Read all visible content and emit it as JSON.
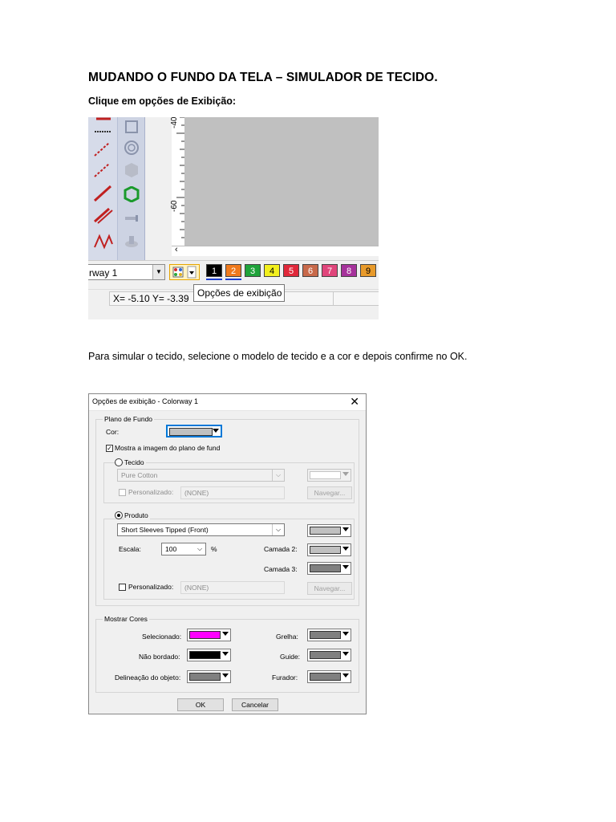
{
  "heading": "MUDANDO O FUNDO DA TELA – SIMULADOR DE TECIDO.",
  "instruction1": "Clique em opções de Exibição:",
  "instruction2": "Para simular o tecido, selecione o modelo de tecido e a cor e depois confirme no OK.",
  "screenshot1": {
    "ruler_labels": [
      "-40",
      "-60"
    ],
    "colorway_value": "rway 1",
    "swatches": [
      {
        "label": "1",
        "color": "#000000",
        "text_color": "#ffffff"
      },
      {
        "label": "2",
        "color": "#f07a1c",
        "text_color": "#ffffff"
      },
      {
        "label": "3",
        "color": "#1fa33a",
        "text_color": "#ffffff"
      },
      {
        "label": "4",
        "color": "#f2ef1d",
        "text_color": "#000000"
      },
      {
        "label": "5",
        "color": "#e0283a",
        "text_color": "#ffffff"
      },
      {
        "label": "6",
        "color": "#c8694a",
        "text_color": "#ffffff"
      },
      {
        "label": "7",
        "color": "#e0457b",
        "text_color": "#ffffff"
      },
      {
        "label": "8",
        "color": "#a6329b",
        "text_color": "#ffffff"
      },
      {
        "label": "9",
        "color": "#e89a2a",
        "text_color": "#000000"
      }
    ],
    "status_text": "X=  -5.10 Y=  -3.39",
    "tooltip": "Opções de exibição"
  },
  "dialog": {
    "title": "Opções de exibição - Colorway 1",
    "close_glyph": "✕",
    "plano_de_fundo": {
      "legend": "Plano de Fundo",
      "cor_label": "Cor:",
      "cor_color": "#c0c0c0",
      "show_image_label": "Mostra a imagem do plano de fund",
      "show_image_checked": "✓",
      "tecido": {
        "label": "Tecido",
        "fabric_value": "Pure Cotton",
        "fabric_color": "#ffffff",
        "personalizado_label": "Personalizado:",
        "personalizado_value": "(NONE)",
        "navegar_label": "Navegar..."
      },
      "produto": {
        "label": "Produto",
        "product_value": "Short Sleeves Tipped (Front)",
        "product_color": "#c0c0c0",
        "escala_label": "Escala:",
        "escala_value": "100",
        "escala_unit": "%",
        "camada2_label": "Camada 2:",
        "camada2_color": "#c0c0c0",
        "camada3_label": "Camada 3:",
        "camada3_color": "#808080",
        "personalizado_label": "Personalizado:",
        "personalizado_value": "(NONE)",
        "navegar_label": "Navegar..."
      }
    },
    "mostrar_cores": {
      "legend": "Mostrar Cores",
      "selecionado_label": "Selecionado:",
      "selecionado_color": "#ff00ff",
      "nao_bordado_label": "Não bordado:",
      "nao_bordado_color": "#000000",
      "delineacao_label": "Delineação do objeto:",
      "delineacao_color": "#808080",
      "grelha_label": "Grelha:",
      "grelha_color": "#808080",
      "guide_label": "Guide:",
      "guide_color": "#808080",
      "furador_label": "Furador:",
      "furador_color": "#808080"
    },
    "ok_label": "OK",
    "cancel_label": "Cancelar"
  }
}
